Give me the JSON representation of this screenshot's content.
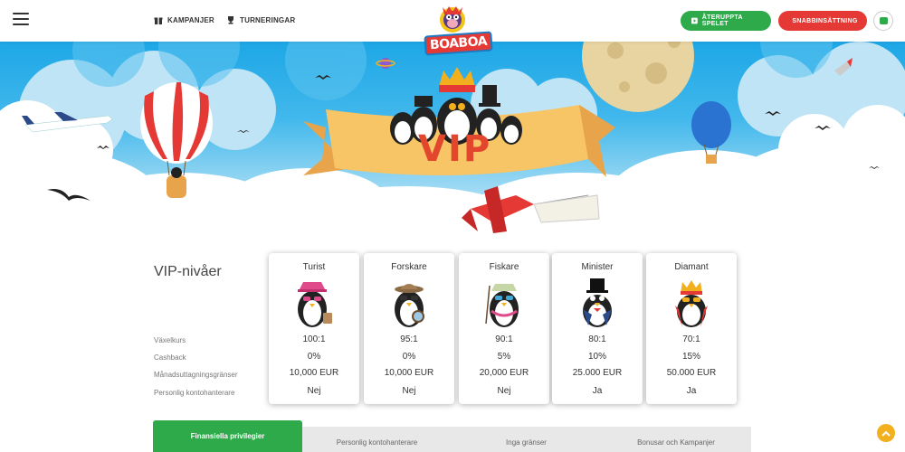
{
  "header": {
    "nav": [
      {
        "label": "KAMPANJER",
        "icon": "gift-icon"
      },
      {
        "label": "TURNERINGAR",
        "icon": "trophy-icon"
      }
    ],
    "logo_text": "BOABOA",
    "resume_label": "ÅTERUPPTA SPELET",
    "quick_label": "SNABBINSÄTTNING"
  },
  "hero": {
    "banner_text": "VIP"
  },
  "levels": {
    "title": "VIP-nivåer",
    "row_labels": [
      "Växelkurs",
      "Cashback",
      "Månadsuttagningsgränser",
      "Personlig kontohanterare"
    ],
    "tiers": [
      {
        "name": "Turist",
        "rate": "100:1",
        "cashback": "0%",
        "limit": "10,000 EUR",
        "manager": "Nej",
        "hat": "pink"
      },
      {
        "name": "Forskare",
        "rate": "95:1",
        "cashback": "0%",
        "limit": "10,000 EUR",
        "manager": "Nej",
        "hat": "brown"
      },
      {
        "name": "Fiskare",
        "rate": "90:1",
        "cashback": "5%",
        "limit": "20,000 EUR",
        "manager": "Nej",
        "hat": "green"
      },
      {
        "name": "Minister",
        "rate": "80:1",
        "cashback": "10%",
        "limit": "25.000 EUR",
        "manager": "Ja",
        "hat": "black"
      },
      {
        "name": "Diamant",
        "rate": "70:1",
        "cashback": "15%",
        "limit": "50.000 EUR",
        "manager": "Ja",
        "hat": "crown"
      }
    ]
  },
  "tabs": [
    {
      "label": "Finansiella privilegier"
    },
    {
      "label": "Personlig kontohanterare"
    },
    {
      "label": "Inga gränser"
    },
    {
      "label": "Bonusar och Kampanjer"
    }
  ],
  "colors": {
    "green": "#2eaa4a",
    "red": "#e53935",
    "sky": "#1da7e6",
    "banner": "#f8c566"
  }
}
